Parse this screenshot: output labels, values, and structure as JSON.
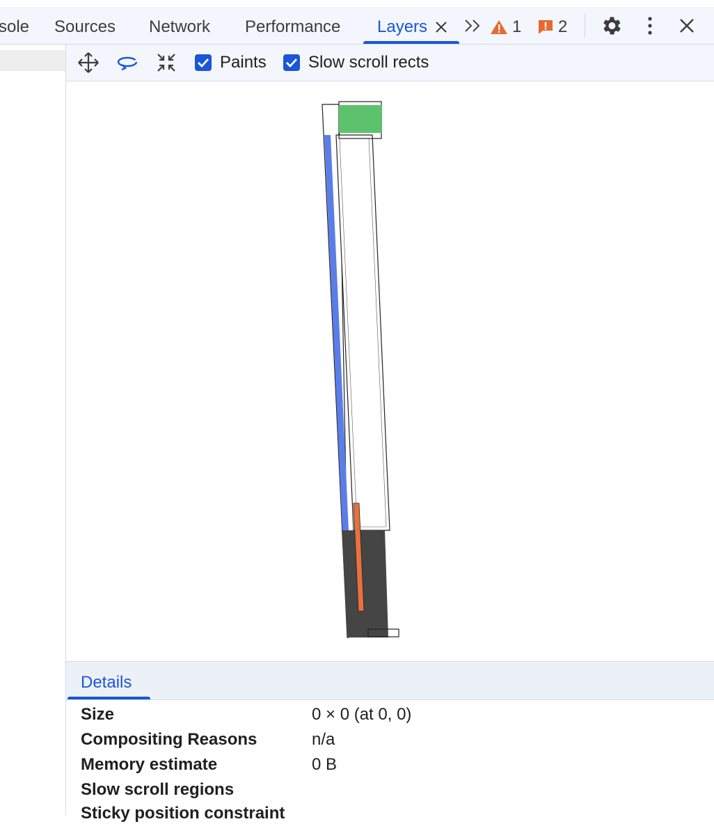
{
  "tabs": [
    {
      "label": "sole"
    },
    {
      "label": "Sources"
    },
    {
      "label": "Network"
    },
    {
      "label": "Performance"
    },
    {
      "label": "Layers",
      "active": true
    }
  ],
  "tab_close_icon": "close-icon",
  "more_tabs_icon": "chevron-double-right-icon",
  "warnings": {
    "icon": "warning-triangle-icon",
    "count": "1",
    "color": "#e8692f"
  },
  "issues": {
    "icon": "issue-flag-icon",
    "count": "2",
    "color": "#e8692f"
  },
  "toolbar_icons": [
    "settings-gear-icon",
    "kebab-menu-icon",
    "close-devtools-icon"
  ],
  "layers_toolbar": {
    "tools": [
      "pan-mode-icon",
      "rotate-mode-icon",
      "reset-transform-icon"
    ],
    "paints_label": "Paints",
    "paints_checked": true,
    "slow_scroll_label": "Slow scroll rects",
    "slow_scroll_checked": true
  },
  "details": {
    "tab_label": "Details",
    "rows": [
      {
        "key": "Size",
        "value": "0 × 0 (at 0, 0)"
      },
      {
        "key": "Compositing Reasons",
        "value": "n/a"
      },
      {
        "key": "Memory estimate",
        "value": "0 B"
      },
      {
        "key": "Slow scroll regions",
        "value": ""
      },
      {
        "key": "Sticky position constraint",
        "value": ""
      }
    ]
  },
  "colors": {
    "accent": "#1a56d6",
    "layer_green": "#5cc26b",
    "layer_blue": "#5b7de8",
    "layer_orange": "#e8713c",
    "layer_dark": "#454545"
  }
}
